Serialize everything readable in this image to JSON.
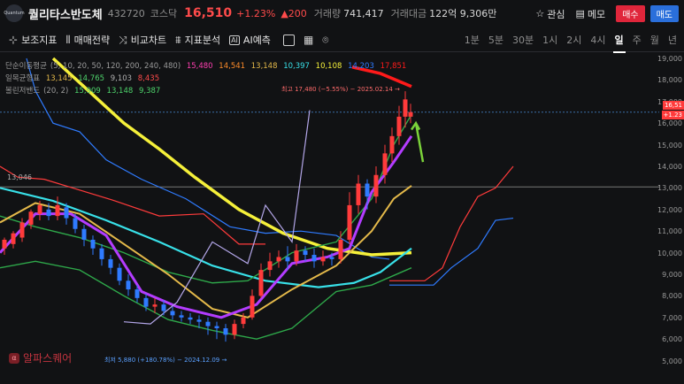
{
  "header": {
    "logo_text": "Quantum",
    "stock_name": "퀄리타스반도체",
    "code": "432720",
    "market": "코스닥",
    "price": "16,510",
    "change_pct": "+1.23%",
    "change_amt": "200",
    "volume_label": "거래량",
    "volume": "741,417",
    "amount_label": "거래대금",
    "amount": "122억 9,306만",
    "watch_label": "관심",
    "memo_label": "메모",
    "buy_label": "매수",
    "sell_label": "매도"
  },
  "toolbar": {
    "aux_indicator": "보조지표",
    "strategy": "매매전략",
    "compare": "비교차트",
    "analysis": "지표분석",
    "ai_badge": "AI",
    "ai_predict": "AI예측",
    "periods": [
      "1분",
      "5분",
      "30분",
      "1시",
      "2시",
      "4시",
      "일",
      "주",
      "월",
      "년"
    ],
    "active_period": "일"
  },
  "legend": {
    "ma": {
      "label": "단순이동평균",
      "params": "(5, 10, 20, 50, 120, 200, 240, 480)",
      "values": [
        "15,480",
        "14,541",
        "13,148",
        "10,397",
        "10,108",
        "14,203",
        "17,851"
      ]
    },
    "ichimoku": {
      "label": "일목균형표",
      "values": [
        "13,145",
        "14,765",
        "9,103",
        "8,435"
      ]
    },
    "bollinger": {
      "label": "볼린저밴드",
      "params": "(20, 2)",
      "values": [
        "15,909",
        "13,148",
        "9,387"
      ]
    }
  },
  "annotations": {
    "high": "최고 17,480 (−5.55%) − 2025.02.14 →",
    "low": "최저 5,880 (+180.78%) − 2024.12.09 →",
    "left_price": "13,046",
    "current_price_tag": "16,51",
    "current_change_tag": "+1.23"
  },
  "y_axis": [
    "19,000",
    "18,000",
    "17,000",
    "16,000",
    "15,000",
    "14,000",
    "13,000",
    "12,000",
    "11,000",
    "10,000",
    "9,000",
    "8,000",
    "7,000",
    "6,000",
    "5,000"
  ],
  "watermark": "알파스퀘어",
  "colors": {
    "up": "#ff3b3b",
    "down": "#2f7bff",
    "ma5": "#ff3fb0",
    "ma20": "#e4b94a",
    "ma120": "#f5f03a",
    "ma200": "#38e0e8",
    "ma480": "#ff1a1a"
  }
}
